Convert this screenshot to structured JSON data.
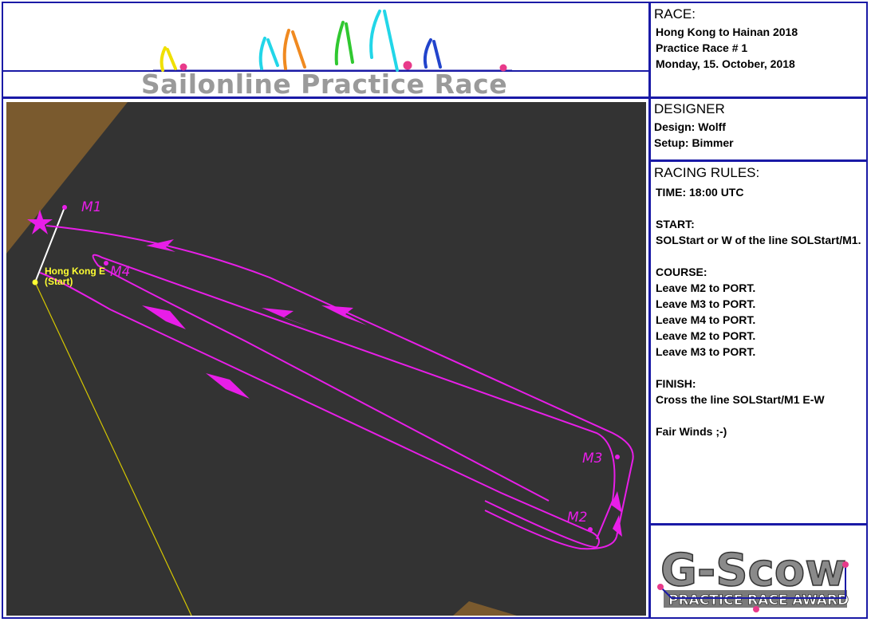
{
  "header": {
    "title": "Sailonline Practice Race"
  },
  "race_panel": {
    "heading": "RACE:",
    "lines": [
      "Hong Kong to Hainan 2018",
      "Practice Race # 1",
      "Monday, 15. October, 2018"
    ]
  },
  "designer_panel": {
    "heading": "DESIGNER",
    "lines": [
      "Design: Wolff",
      "Setup: Bimmer"
    ]
  },
  "rules_panel": {
    "heading": "RACING RULES:",
    "lines": [
      "TIME: 18:00 UTC",
      "",
      "START:",
      "SOLStart or W of the line SOLStart/M1.",
      "",
      "COURSE:",
      "Leave M2 to PORT.",
      "Leave M3 to PORT.",
      "Leave M4 to PORT.",
      "Leave M2 to PORT.",
      "Leave M3 to PORT.",
      "",
      "FINISH:",
      "Cross the line SOLStart/M1 E-W",
      "",
      "Fair Winds ;-)"
    ]
  },
  "map": {
    "marks": {
      "m1": "M1",
      "m2": "M2",
      "m3": "M3",
      "m4": "M4"
    },
    "start_label_1": "Hong Kong E",
    "start_label_2": "(Start)",
    "colors": {
      "water": "#333333",
      "land": "#7a5a2e",
      "course": "#e81ee8",
      "start_line": "#ffffff",
      "rhumb": "#d6c800"
    }
  },
  "award": {
    "title": "G-Scow",
    "subtitle": "PRACTICE RACE AWARD"
  }
}
